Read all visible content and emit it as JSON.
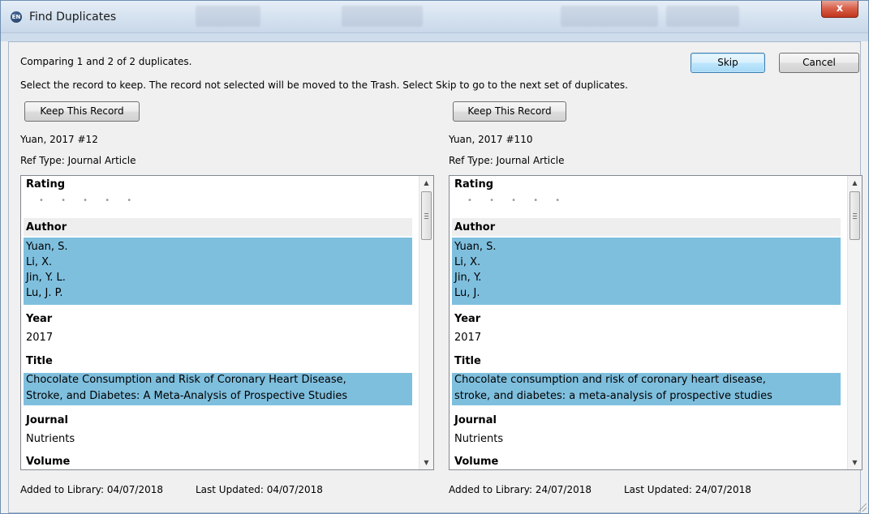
{
  "window": {
    "title": "Find Duplicates",
    "close_glyph": "x"
  },
  "header": {
    "comparing": "Comparing 1 and 2 of 2 duplicates.",
    "instructions": "Select the record to keep. The record not selected will be moved to the Trash. Select Skip to go to the next set of duplicates.",
    "skip_label": "Skip",
    "cancel_label": "Cancel"
  },
  "records": [
    {
      "keep_label": "Keep This Record",
      "citation": "Yuan, 2017 #12",
      "ref_type": "Ref Type: Journal Article",
      "rating_label": "Rating",
      "author_label": "Author",
      "authors": [
        "Yuan, S.",
        "Li, X.",
        "Jin, Y. L.",
        "Lu, J. P."
      ],
      "year_label": "Year",
      "year": "2017",
      "title_label": "Title",
      "title_lines": [
        "Chocolate Consumption and Risk of Coronary Heart Disease,",
        "Stroke, and Diabetes: A Meta-Analysis of Prospective Studies"
      ],
      "journal_label": "Journal",
      "journal": "Nutrients",
      "volume_label": "Volume",
      "added": "Added to Library: 04/07/2018",
      "updated": "Last Updated: 04/07/2018"
    },
    {
      "keep_label": "Keep This Record",
      "citation": "Yuan, 2017 #110",
      "ref_type": "Ref Type: Journal Article",
      "rating_label": "Rating",
      "author_label": "Author",
      "authors": [
        "Yuan, S.",
        "Li, X.",
        "Jin, Y.",
        "Lu, J."
      ],
      "year_label": "Year",
      "year": "2017",
      "title_label": "Title",
      "title_lines": [
        "Chocolate consumption and risk of coronary heart disease,",
        "stroke, and diabetes: a meta-analysis of prospective studies"
      ],
      "journal_label": "Journal",
      "journal": "Nutrients",
      "volume_label": "Volume",
      "added": "Added to Library: 24/07/2018",
      "updated": "Last Updated: 24/07/2018"
    }
  ],
  "colors": {
    "highlight": "#7fbfde",
    "close_button": "#c1351c",
    "panel_border": "#828790"
  }
}
